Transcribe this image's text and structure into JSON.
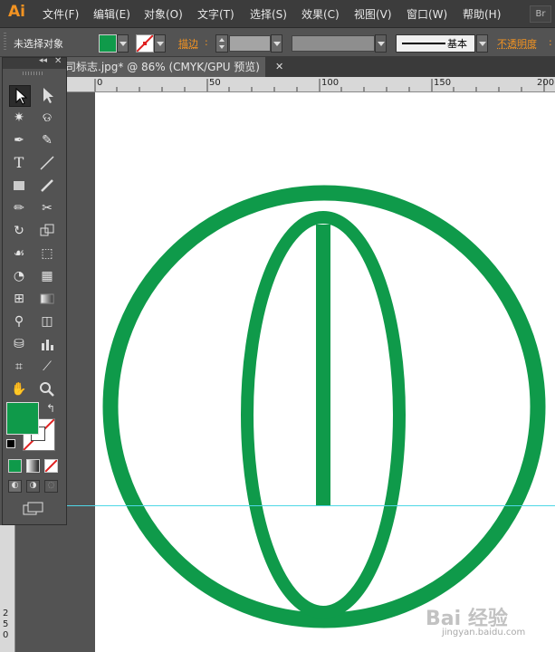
{
  "app": {
    "logo_text": "Ai",
    "bridge_label": "Br"
  },
  "menu": [
    "文件(F)",
    "编辑(E)",
    "对象(O)",
    "文字(T)",
    "选择(S)",
    "效果(C)",
    "视图(V)",
    "窗口(W)",
    "帮助(H)"
  ],
  "control_bar": {
    "selection_status": "未选择对象",
    "stroke_label": "描边",
    "stroke_style_label": "基本",
    "opacity_label": "不透明度",
    "fill_color": "#0f9a4a",
    "label_color": "#f29322"
  },
  "document": {
    "tab_title": "司标志.jpg* @ 86% (CMYK/GPU 预览)",
    "close_icon": "close-icon",
    "zoom_percent": 86,
    "color_mode": "CMYK/GPU 预览"
  },
  "ruler": {
    "h_labels": [
      "0",
      "50",
      "100",
      "150",
      "200"
    ],
    "v_labels": [
      "2",
      "5",
      "0"
    ]
  },
  "toolbox": {
    "fill_color": "#0f9a4a",
    "stroke_color": "#ffffff",
    "icons": [
      "selection-icon",
      "direct-selection-icon",
      "magic-wand-icon",
      "lasso-icon",
      "pen-icon",
      "curvature-icon",
      "type-icon",
      "line-icon",
      "rectangle-icon",
      "paintbrush-icon",
      "pencil-icon",
      "scissors-icon",
      "rotate-icon",
      "scale-icon",
      "warp-icon",
      "free-transform-icon",
      "shape-builder-icon",
      "perspective-grid-icon",
      "mesh-icon",
      "gradient-icon",
      "eyedropper-icon",
      "blend-icon",
      "symbol-sprayer-icon",
      "column-graph-icon",
      "artboard-icon",
      "slice-icon",
      "hand-icon",
      "zoom-icon"
    ]
  },
  "artwork": {
    "logo_color": "#0f9a4a",
    "guide_color": "#4fd7e6"
  },
  "watermark": {
    "text": "Bai 经验",
    "sub": "jingyan.baidu.com"
  }
}
